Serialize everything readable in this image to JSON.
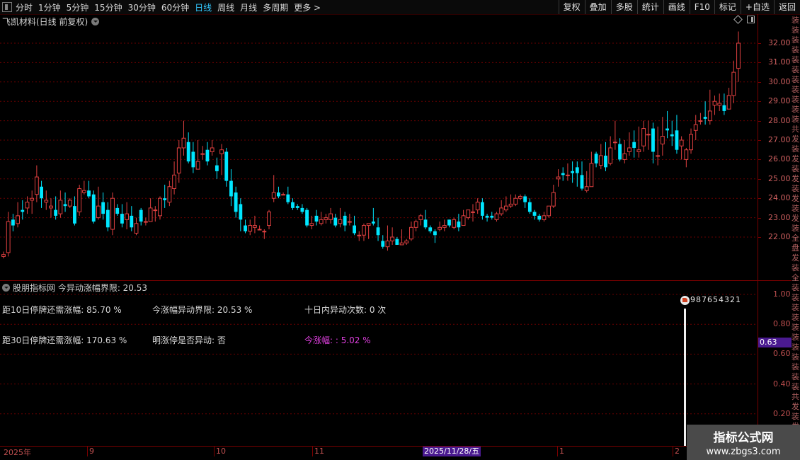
{
  "toolbar": {
    "periods": [
      "分时",
      "1分钟",
      "5分钟",
      "15分钟",
      "30分钟",
      "60分钟",
      "日线",
      "周线",
      "月线",
      "多周期",
      "更多 >"
    ],
    "active_period": "日线",
    "right_buttons": [
      "复权",
      "叠加",
      "多股",
      "统计",
      "画线",
      "F10",
      "标记",
      "+自选",
      "返回"
    ]
  },
  "main_chart": {
    "title": "飞凯材料(日线 前复权)",
    "price_labels": [
      "32.00",
      "31.00",
      "30.00",
      "29.00",
      "28.00",
      "27.00",
      "26.00",
      "25.00",
      "24.00",
      "23.00",
      "22.00"
    ],
    "right_cut_text": "装装装装装装装装装装装共发装发装发装发装发装全盘发装全盘发装",
    "colors": {
      "up": "#e04040",
      "down": "#00e6ff",
      "grid": "#6a0000"
    }
  },
  "indicator": {
    "title": "股朋指标网 今异动涨幅界限: 20.53",
    "stats": {
      "dist10": "距10日停牌还需涨幅: 85.70 %",
      "threshold": "今涨幅异动界限: 20.53 %",
      "count": "十日内异动次数: 0 次",
      "dist30": "距30日停牌还需涨幅: 170.63 %",
      "tomorrow": "明涨停是否异动: 否",
      "today": "今涨幅: : 5.02 %"
    },
    "axis_labels": [
      "1.00",
      "0.80",
      "0.60",
      "0.40",
      "0.20"
    ],
    "current_value": "0.63",
    "digits": "987654321"
  },
  "date_axis": {
    "labels": [
      "2025年",
      "9",
      "10",
      "11",
      "1",
      "2"
    ],
    "highlight": "2025/11/28/五"
  },
  "watermark": {
    "line1": "指标公式网",
    "line2": "www.zbgs3.com"
  },
  "chart_data": {
    "type": "candlestick",
    "yrange": [
      21.2,
      32.9
    ],
    "candles": [
      [
        21.0,
        21.1,
        21.25,
        20.9
      ],
      [
        21.2,
        22.8,
        23.3,
        21.0
      ],
      [
        22.9,
        22.6,
        23.2,
        22.3
      ],
      [
        22.7,
        23.1,
        23.8,
        22.5
      ],
      [
        23.4,
        23.3,
        23.9,
        22.9
      ],
      [
        23.5,
        23.8,
        24.1,
        23.2
      ],
      [
        23.9,
        24.0,
        24.4,
        23.2
      ],
      [
        24.2,
        25.1,
        25.7,
        23.8
      ],
      [
        24.6,
        24.0,
        24.9,
        23.5
      ],
      [
        23.8,
        23.9,
        24.4,
        23.4
      ],
      [
        23.5,
        23.6,
        24.0,
        23.0
      ],
      [
        23.4,
        23.1,
        24.1,
        22.9
      ],
      [
        23.2,
        23.9,
        24.4,
        23.0
      ],
      [
        23.7,
        23.6,
        24.3,
        23.3
      ],
      [
        23.6,
        23.9,
        24.0,
        23.5
      ],
      [
        23.6,
        22.7,
        24.1,
        22.6
      ],
      [
        23.3,
        24.5,
        24.7,
        23.1
      ],
      [
        24.3,
        24.4,
        24.9,
        24.2
      ],
      [
        24.4,
        24.1,
        24.9,
        24.0
      ],
      [
        24.2,
        22.8,
        24.4,
        22.7
      ],
      [
        23.0,
        23.6,
        24.6,
        22.9
      ],
      [
        23.8,
        23.2,
        24.3,
        22.9
      ],
      [
        23.4,
        22.5,
        23.8,
        22.3
      ],
      [
        22.4,
        24.0,
        24.3,
        22.1
      ],
      [
        23.5,
        23.2,
        23.7,
        23.1
      ],
      [
        23.2,
        22.7,
        23.7,
        22.5
      ],
      [
        22.9,
        23.2,
        23.8,
        22.4
      ],
      [
        23.1,
        22.5,
        23.6,
        22.3
      ],
      [
        22.2,
        22.7,
        23.0,
        22.1
      ],
      [
        23.4,
        22.8,
        23.5,
        22.6
      ],
      [
        22.8,
        22.8,
        23.0,
        22.6
      ],
      [
        22.8,
        23.5,
        24.0,
        22.9
      ],
      [
        23.4,
        23.4,
        23.6,
        22.8
      ],
      [
        23.1,
        24.0,
        24.1,
        22.9
      ],
      [
        24.0,
        23.9,
        24.7,
        23.5
      ],
      [
        23.8,
        24.6,
        24.9,
        23.6
      ],
      [
        24.5,
        25.2,
        25.9,
        24.2
      ],
      [
        25.3,
        26.6,
        27.0,
        24.8
      ],
      [
        26.6,
        27.1,
        28.0,
        26.2
      ],
      [
        26.9,
        25.9,
        27.4,
        25.8
      ],
      [
        26.4,
        25.6,
        26.9,
        25.3
      ],
      [
        25.5,
        25.9,
        27.0,
        25.6
      ],
      [
        26.3,
        26.3,
        26.7,
        26.0
      ],
      [
        26.5,
        25.9,
        26.9,
        25.7
      ],
      [
        26.4,
        26.6,
        27.0,
        26.2
      ],
      [
        25.7,
        25.4,
        26.1,
        25.0
      ],
      [
        26.3,
        26.5,
        26.8,
        25.2
      ],
      [
        26.4,
        24.9,
        26.6,
        24.6
      ],
      [
        24.9,
        24.1,
        25.5,
        23.6
      ],
      [
        24.3,
        23.3,
        24.6,
        23.0
      ],
      [
        23.7,
        22.9,
        24.0,
        22.3
      ],
      [
        22.6,
        22.3,
        22.9,
        22.2
      ],
      [
        22.3,
        22.6,
        22.9,
        22.1
      ],
      [
        22.5,
        22.6,
        23.1,
        22.2
      ],
      [
        22.4,
        22.4,
        22.6,
        22.4
      ],
      [
        22.3,
        22.3,
        22.4,
        21.9
      ],
      [
        22.6,
        23.3,
        23.4,
        22.4
      ],
      [
        24.0,
        24.3,
        25.2,
        23.8
      ],
      [
        24.3,
        24.1,
        24.6,
        24.0
      ],
      [
        24.2,
        24.2,
        24.3,
        24.2
      ],
      [
        24.2,
        23.8,
        24.6,
        23.7
      ],
      [
        23.8,
        23.5,
        24.0,
        23.4
      ],
      [
        23.6,
        23.5,
        23.7,
        23.4
      ],
      [
        23.5,
        23.3,
        23.7,
        23.2
      ],
      [
        23.4,
        22.6,
        23.5,
        22.5
      ],
      [
        22.6,
        22.7,
        23.1,
        22.4
      ],
      [
        23.1,
        22.8,
        23.4,
        22.6
      ],
      [
        22.7,
        22.9,
        23.3,
        22.6
      ],
      [
        22.9,
        23.0,
        23.2,
        22.7
      ],
      [
        22.9,
        23.2,
        23.5,
        22.7
      ],
      [
        23.0,
        22.6,
        23.2,
        22.5
      ],
      [
        22.7,
        22.9,
        23.5,
        22.5
      ],
      [
        23.1,
        22.6,
        23.3,
        22.3
      ],
      [
        22.8,
        22.8,
        23.2,
        22.6
      ],
      [
        22.6,
        22.2,
        23.1,
        22.1
      ],
      [
        22.1,
        22.1,
        22.3,
        21.8
      ],
      [
        22.1,
        22.6,
        22.7,
        21.8
      ],
      [
        22.6,
        22.7,
        22.7,
        21.9
      ],
      [
        22.8,
        22.7,
        23.5,
        22.6
      ],
      [
        22.5,
        22.1,
        23.0,
        21.8
      ],
      [
        21.8,
        21.5,
        22.1,
        21.4
      ],
      [
        21.5,
        21.8,
        22.6,
        21.3
      ],
      [
        21.8,
        22.0,
        22.5,
        21.6
      ],
      [
        21.9,
        21.6,
        22.0,
        21.6
      ],
      [
        21.6,
        21.7,
        22.4,
        21.6
      ],
      [
        21.7,
        21.8,
        21.9,
        21.6
      ],
      [
        21.9,
        22.5,
        22.8,
        21.8
      ],
      [
        22.5,
        22.8,
        22.9,
        22.3
      ],
      [
        22.9,
        23.1,
        23.2,
        22.6
      ],
      [
        22.9,
        22.5,
        23.4,
        22.4
      ],
      [
        22.5,
        22.3,
        22.6,
        22.2
      ],
      [
        22.3,
        22.1,
        22.4,
        21.7
      ],
      [
        22.4,
        22.5,
        22.8,
        22.3
      ],
      [
        22.5,
        22.6,
        22.9,
        22.3
      ],
      [
        22.9,
        22.6,
        22.9,
        22.5
      ],
      [
        22.5,
        22.9,
        23.0,
        22.4
      ],
      [
        22.8,
        22.5,
        23.2,
        22.3
      ],
      [
        22.6,
        23.1,
        23.4,
        22.8
      ],
      [
        23.0,
        23.4,
        23.4,
        22.9
      ],
      [
        23.3,
        23.3,
        23.7,
        22.8
      ],
      [
        23.4,
        23.8,
        24.0,
        23.2
      ],
      [
        23.8,
        23.1,
        24.0,
        22.9
      ],
      [
        23.1,
        23.0,
        23.2,
        22.8
      ],
      [
        23.1,
        23.0,
        23.3,
        22.9
      ],
      [
        22.9,
        23.2,
        23.3,
        22.8
      ],
      [
        23.2,
        23.5,
        23.9,
        23.1
      ],
      [
        23.4,
        23.6,
        24.1,
        23.3
      ],
      [
        23.6,
        23.7,
        24.2,
        23.5
      ],
      [
        23.7,
        24.0,
        24.2,
        23.6
      ],
      [
        24.0,
        24.1,
        24.2,
        23.9
      ],
      [
        24.1,
        23.8,
        24.2,
        23.5
      ],
      [
        23.8,
        23.3,
        24.0,
        23.2
      ],
      [
        23.3,
        23.1,
        23.4,
        22.9
      ],
      [
        23.1,
        22.9,
        23.2,
        22.8
      ],
      [
        22.9,
        23.1,
        23.3,
        22.8
      ],
      [
        23.1,
        23.6,
        23.6,
        23.0
      ],
      [
        23.6,
        24.3,
        24.7,
        23.5
      ],
      [
        25.0,
        25.1,
        25.5,
        24.6
      ],
      [
        25.3,
        25.2,
        25.6,
        24.9
      ],
      [
        25.2,
        25.2,
        25.8,
        24.9
      ],
      [
        25.4,
        25.3,
        25.9,
        24.8
      ],
      [
        25.6,
        25.3,
        25.9,
        24.6
      ],
      [
        25.2,
        24.5,
        25.9,
        24.4
      ],
      [
        24.4,
        24.6,
        25.4,
        24.3
      ],
      [
        24.6,
        25.8,
        26.4,
        24.6
      ],
      [
        26.3,
        25.8,
        26.4,
        25.6
      ],
      [
        25.7,
        26.2,
        26.8,
        25.5
      ],
      [
        26.2,
        25.6,
        26.9,
        25.4
      ],
      [
        25.8,
        26.6,
        27.2,
        25.7
      ],
      [
        26.9,
        26.9,
        28.0,
        26.5
      ],
      [
        26.8,
        26.0,
        27.1,
        25.9
      ],
      [
        26.0,
        26.3,
        27.0,
        25.8
      ],
      [
        26.4,
        26.6,
        27.4,
        26.2
      ],
      [
        26.9,
        26.6,
        27.5,
        26.1
      ],
      [
        26.4,
        26.5,
        27.7,
        26.1
      ],
      [
        26.7,
        27.6,
        28.0,
        26.4
      ],
      [
        27.3,
        27.3,
        28.0,
        26.5
      ],
      [
        27.6,
        26.4,
        27.9,
        25.8
      ],
      [
        26.2,
        26.2,
        27.7,
        25.7
      ],
      [
        26.8,
        27.2,
        28.2,
        26.2
      ],
      [
        27.6,
        27.5,
        28.5,
        27.1
      ],
      [
        27.3,
        27.2,
        28.0,
        26.7
      ],
      [
        27.5,
        26.5,
        28.3,
        26.3
      ],
      [
        26.7,
        27.0,
        27.2,
        26.0
      ],
      [
        26.0,
        26.5,
        26.6,
        25.6
      ],
      [
        26.5,
        27.3,
        27.6,
        26.3
      ],
      [
        27.5,
        27.8,
        28.3,
        27.0
      ],
      [
        28.0,
        28.0,
        28.4,
        27.8
      ],
      [
        28.2,
        28.1,
        29.0,
        27.8
      ],
      [
        28.0,
        28.5,
        29.6,
        27.8
      ],
      [
        28.8,
        29.0,
        29.3,
        28.3
      ],
      [
        28.8,
        28.9,
        29.4,
        28.5
      ],
      [
        28.8,
        28.5,
        29.4,
        28.3
      ],
      [
        28.6,
        29.3,
        29.7,
        28.7
      ],
      [
        29.3,
        30.5,
        31.1,
        28.9
      ],
      [
        30.7,
        32.0,
        32.6,
        30.0
      ]
    ]
  }
}
